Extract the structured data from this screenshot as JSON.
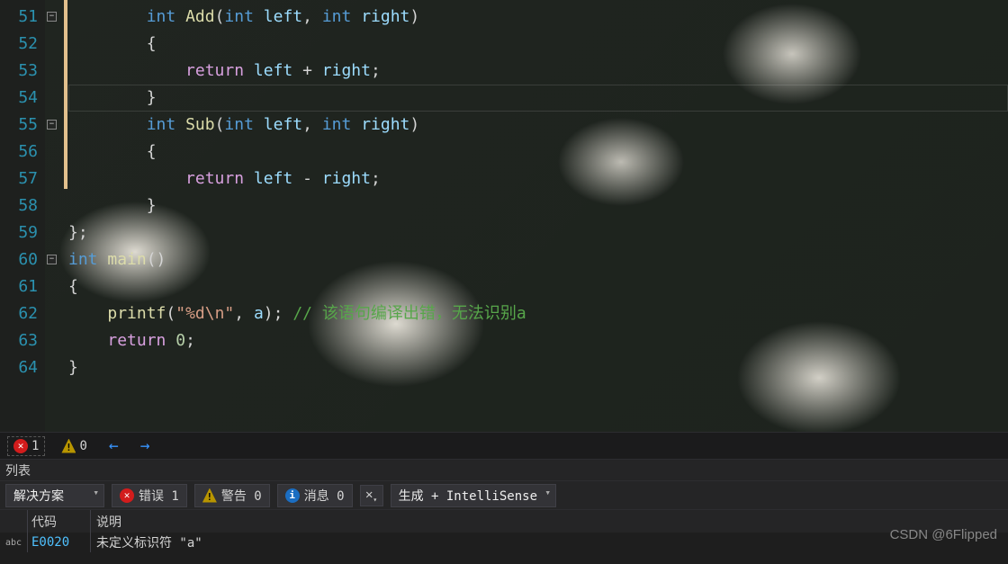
{
  "editor": {
    "lines": [
      {
        "num": 51,
        "changed": true,
        "fold": "-",
        "indent": 2,
        "tokens": [
          [
            "type",
            "int "
          ],
          [
            "fn",
            "Add"
          ],
          [
            "punc",
            "("
          ],
          [
            "type",
            "int "
          ],
          [
            "param",
            "left"
          ],
          [
            "punc",
            ", "
          ],
          [
            "type",
            "int "
          ],
          [
            "param",
            "right"
          ],
          [
            "punc",
            ")"
          ]
        ]
      },
      {
        "num": 52,
        "changed": true,
        "indent": 2,
        "tokens": [
          [
            "punc",
            "{"
          ]
        ]
      },
      {
        "num": 53,
        "changed": true,
        "indent": 3,
        "tokens": [
          [
            "kw",
            "return "
          ],
          [
            "param",
            "left"
          ],
          [
            "punc",
            " + "
          ],
          [
            "param",
            "right"
          ],
          [
            "punc",
            ";"
          ]
        ]
      },
      {
        "num": 54,
        "changed": true,
        "indent": 2,
        "current": true,
        "tokens": [
          [
            "punc",
            "}"
          ]
        ]
      },
      {
        "num": 55,
        "changed": true,
        "fold": "-",
        "indent": 2,
        "tokens": [
          [
            "type",
            "int "
          ],
          [
            "fn",
            "Sub"
          ],
          [
            "punc",
            "("
          ],
          [
            "type",
            "int "
          ],
          [
            "param",
            "left"
          ],
          [
            "punc",
            ", "
          ],
          [
            "type",
            "int "
          ],
          [
            "param",
            "right"
          ],
          [
            "punc",
            ")"
          ]
        ]
      },
      {
        "num": 56,
        "changed": true,
        "indent": 2,
        "tokens": [
          [
            "punc",
            "{"
          ]
        ]
      },
      {
        "num": 57,
        "changed": true,
        "indent": 3,
        "tokens": [
          [
            "kw",
            "return "
          ],
          [
            "param",
            "left"
          ],
          [
            "punc",
            " - "
          ],
          [
            "param",
            "right"
          ],
          [
            "punc",
            ";"
          ]
        ]
      },
      {
        "num": 58,
        "changed": false,
        "indent": 2,
        "tokens": [
          [
            "punc",
            "}"
          ]
        ]
      },
      {
        "num": 59,
        "changed": false,
        "indent": 0,
        "tokens": [
          [
            "punc",
            "};"
          ]
        ]
      },
      {
        "num": 60,
        "changed": false,
        "fold": "-",
        "indent": 0,
        "tokens": [
          [
            "type",
            "int "
          ],
          [
            "fn",
            "main"
          ],
          [
            "punc",
            "()"
          ]
        ]
      },
      {
        "num": 61,
        "changed": false,
        "indent": 0,
        "tokens": [
          [
            "punc",
            "{"
          ]
        ]
      },
      {
        "num": 62,
        "changed": false,
        "indent": 1,
        "tokens": [
          [
            "fn",
            "printf"
          ],
          [
            "punc",
            "("
          ],
          [
            "str",
            "\"%d\\n\""
          ],
          [
            "punc",
            ", "
          ],
          [
            "param",
            "a"
          ],
          [
            "punc",
            "); "
          ],
          [
            "comment",
            "// 该语句编译出错，无法识别a"
          ]
        ]
      },
      {
        "num": 63,
        "changed": false,
        "indent": 1,
        "tokens": [
          [
            "kw",
            "return "
          ],
          [
            "num",
            "0"
          ],
          [
            "punc",
            ";"
          ]
        ]
      },
      {
        "num": 64,
        "changed": false,
        "indent": 0,
        "tokens": [
          [
            "punc",
            "}"
          ]
        ]
      }
    ]
  },
  "status": {
    "errors": "1",
    "warnings": "0"
  },
  "panel": {
    "title": "列表"
  },
  "filter": {
    "scope": "解决方案",
    "errors_label": "错误 1",
    "warnings_label": "警告 0",
    "messages_label": "消息 0",
    "source": "生成 + IntelliSense"
  },
  "columns": {
    "code": "代码",
    "desc": "说明"
  },
  "error_row": {
    "icon": "abc",
    "code": "E0020",
    "desc": "未定义标识符 \"a\""
  },
  "watermark": "CSDN @6Flipped"
}
